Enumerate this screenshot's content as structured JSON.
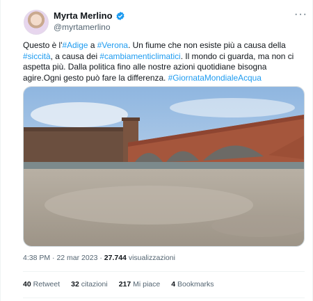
{
  "author": {
    "name": "Myrta Merlino",
    "handle": "@myrtamerlino"
  },
  "tweet": {
    "text_parts": [
      {
        "t": "Questo è l'",
        "tag": false
      },
      {
        "t": "#Adige",
        "tag": true
      },
      {
        "t": " a ",
        "tag": false
      },
      {
        "t": "#Verona",
        "tag": true
      },
      {
        "t": ". Un fiume che non esiste più a causa della ",
        "tag": false
      },
      {
        "t": "#siccità",
        "tag": true
      },
      {
        "t": ", a causa dei ",
        "tag": false
      },
      {
        "t": "#cambiamenticlimatici",
        "tag": true
      },
      {
        "t": ". Il mondo ci guarda, ma non ci aspetta più. Dalla politica fino alle nostre azioni quotidiane bisogna agire.Ogni gesto può fare la differenza. ",
        "tag": false
      },
      {
        "t": "#GiornataMondialeAcqua",
        "tag": true
      }
    ]
  },
  "meta": {
    "time": "4:38 PM",
    "date": "22 mar 2023",
    "views_count": "27.744",
    "views_label": "visualizzazioni"
  },
  "stats": {
    "retweets_count": "40",
    "retweets_label": "Retweet",
    "quotes_count": "32",
    "quotes_label": "citazioni",
    "likes_count": "217",
    "likes_label": "Mi piace",
    "bookmarks_count": "4",
    "bookmarks_label": "Bookmarks"
  },
  "colors": {
    "link": "#1d9bf0",
    "text": "#0f1419",
    "muted": "#536471",
    "verified": "#1d9bf0"
  },
  "icons": {
    "verified": "verified-badge-icon",
    "more": "more-options-icon"
  }
}
